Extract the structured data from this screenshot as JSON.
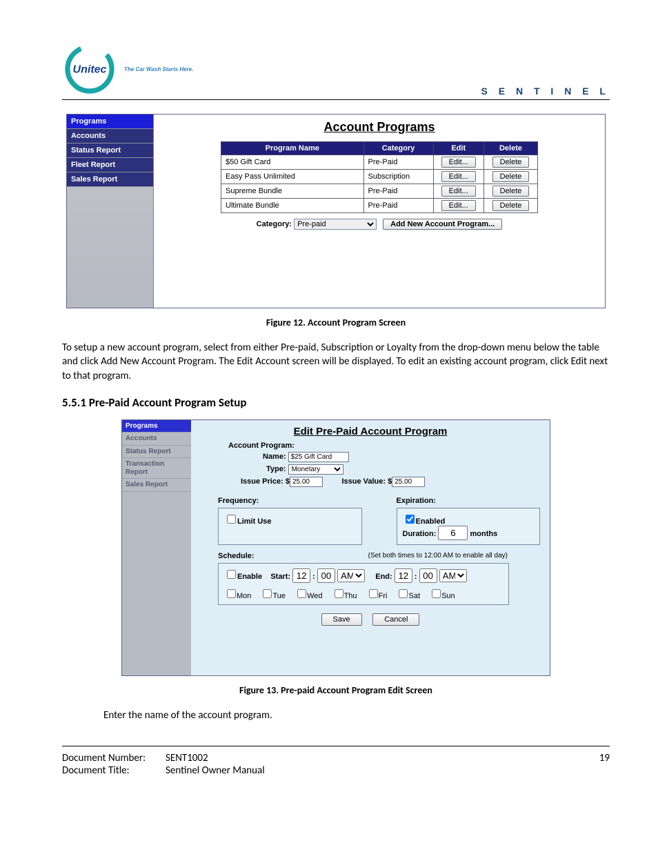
{
  "header": {
    "tagline": "The Car Wash Starts Here.",
    "product": "S E N T I N E L"
  },
  "fig12": {
    "sidebar": [
      "Programs",
      "Accounts",
      "Status Report",
      "Fleet Report",
      "Sales Report"
    ],
    "title": "Account Programs",
    "columns": [
      "Program Name",
      "Category",
      "Edit",
      "Delete"
    ],
    "rows": [
      {
        "name": "$50 Gift Card",
        "category": "Pre-Paid",
        "edit": "Edit...",
        "del": "Delete"
      },
      {
        "name": "Easy Pass Unlimited",
        "category": "Subscription",
        "edit": "Edit...",
        "del": "Delete"
      },
      {
        "name": "Supreme Bundle",
        "category": "Pre-Paid",
        "edit": "Edit...",
        "del": "Delete"
      },
      {
        "name": "Ultimate Bundle",
        "category": "Pre-Paid",
        "edit": "Edit...",
        "del": "Delete"
      }
    ],
    "category_label": "Category:",
    "category_value": "Pre-paid",
    "add_button": "Add New Account Program...",
    "caption": "Figure 12. Account Program Screen"
  },
  "para1": "To setup a new account program, select from either Pre-paid, Subscription or Loyalty from the drop-down menu below the table and click Add New Account Program. The Edit Account screen will be displayed. To edit an existing account program, click Edit next to that program.",
  "section": "5.5.1  Pre-Paid Account Program Setup",
  "fig13": {
    "sidebar": [
      "Programs",
      "Accounts",
      "Status Report",
      "Transaction Report",
      "Sales Report"
    ],
    "title": "Edit Pre-Paid Account Program",
    "account_program_label": "Account Program:",
    "name_label": "Name:",
    "name_value": "$25 Gift Card",
    "type_label": "Type:",
    "type_value": "Monetary",
    "issue_price_label": "Issue Price:  $",
    "issue_price_value": "25.00",
    "issue_value_label": "Issue Value:  $",
    "issue_value_value": "25.00",
    "frequency_title": "Frequency:",
    "limit_use": "Limit Use",
    "expiration_title": "Expiration:",
    "enabled": "Enabled",
    "duration_label": "Duration:",
    "duration_value": "6",
    "duration_unit": "months",
    "schedule_title": "Schedule:",
    "schedule_note": "(Set both times to 12:00 AM to enable all day)",
    "enable": "Enable",
    "start_label": "Start:",
    "end_label": "End:",
    "time_h": "12",
    "time_m": "00",
    "ampm": "AM",
    "days": [
      "Mon",
      "Tue",
      "Wed",
      "Thu",
      "Fri",
      "Sat",
      "Sun"
    ],
    "save": "Save",
    "cancel": "Cancel",
    "caption": "Figure 13. Pre-paid Account Program Edit Screen"
  },
  "para2": "Enter the name of the account program.",
  "footer": {
    "docnum_label": "Document Number:",
    "docnum": "SENT1002",
    "title_label": "Document Title:",
    "title": "Sentinel Owner Manual",
    "page": "19"
  }
}
